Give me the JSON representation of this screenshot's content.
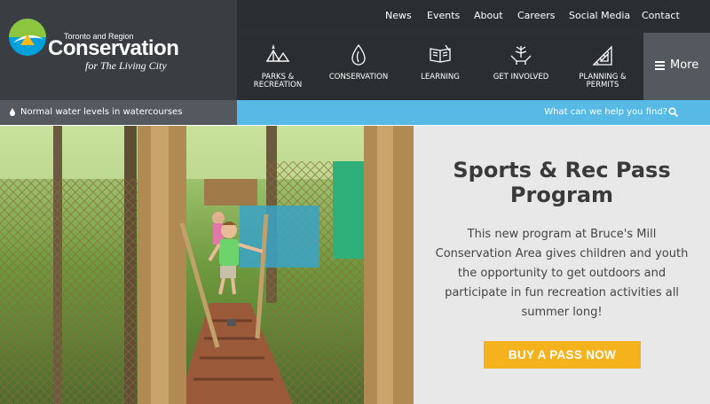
{
  "logo": {
    "line1": "Toronto and Region",
    "line2": "Conservation",
    "tagline": "for The Living City",
    "colors": {
      "green": "#8cc63f",
      "blue": "#00a0dc",
      "yellow": "#fdb913"
    }
  },
  "top_nav": [
    "News",
    "Events",
    "About",
    "Careers",
    "Social Media",
    "Contact"
  ],
  "main_nav": [
    {
      "label": "PARKS & RECREATION",
      "icon": "tents-icon"
    },
    {
      "label": "CONSERVATION",
      "icon": "leaf-drop-icon"
    },
    {
      "label": "LEARNING",
      "icon": "open-book-icon"
    },
    {
      "label": "GET INVOLVED",
      "icon": "seedling-hands-icon"
    },
    {
      "label": "PLANNING & PERMITS",
      "icon": "set-square-icon"
    }
  ],
  "more_label": "More",
  "status": {
    "text": "Normal water levels in watercourses",
    "icon": "water-drop-icon"
  },
  "help": {
    "text": "What can we help you find?",
    "icon": "search-icon"
  },
  "hero": {
    "title": "Sports & Rec Pass Program",
    "body": "This new program at Bruce's Mill Conservation Area gives children and youth the opportunity to get outdoors and participate in fun recreation activities all summer long!",
    "cta": "BUY A PASS NOW",
    "photo_description": "children on a rope bridge in the forest"
  },
  "colors": {
    "header_bg": "#2b2e31",
    "logo_bg": "#3a3e42",
    "status_bg": "#53595e",
    "help_bg": "#56b9e6",
    "panel_bg": "#e8e8e8",
    "cta_bg": "#f5b21d"
  }
}
